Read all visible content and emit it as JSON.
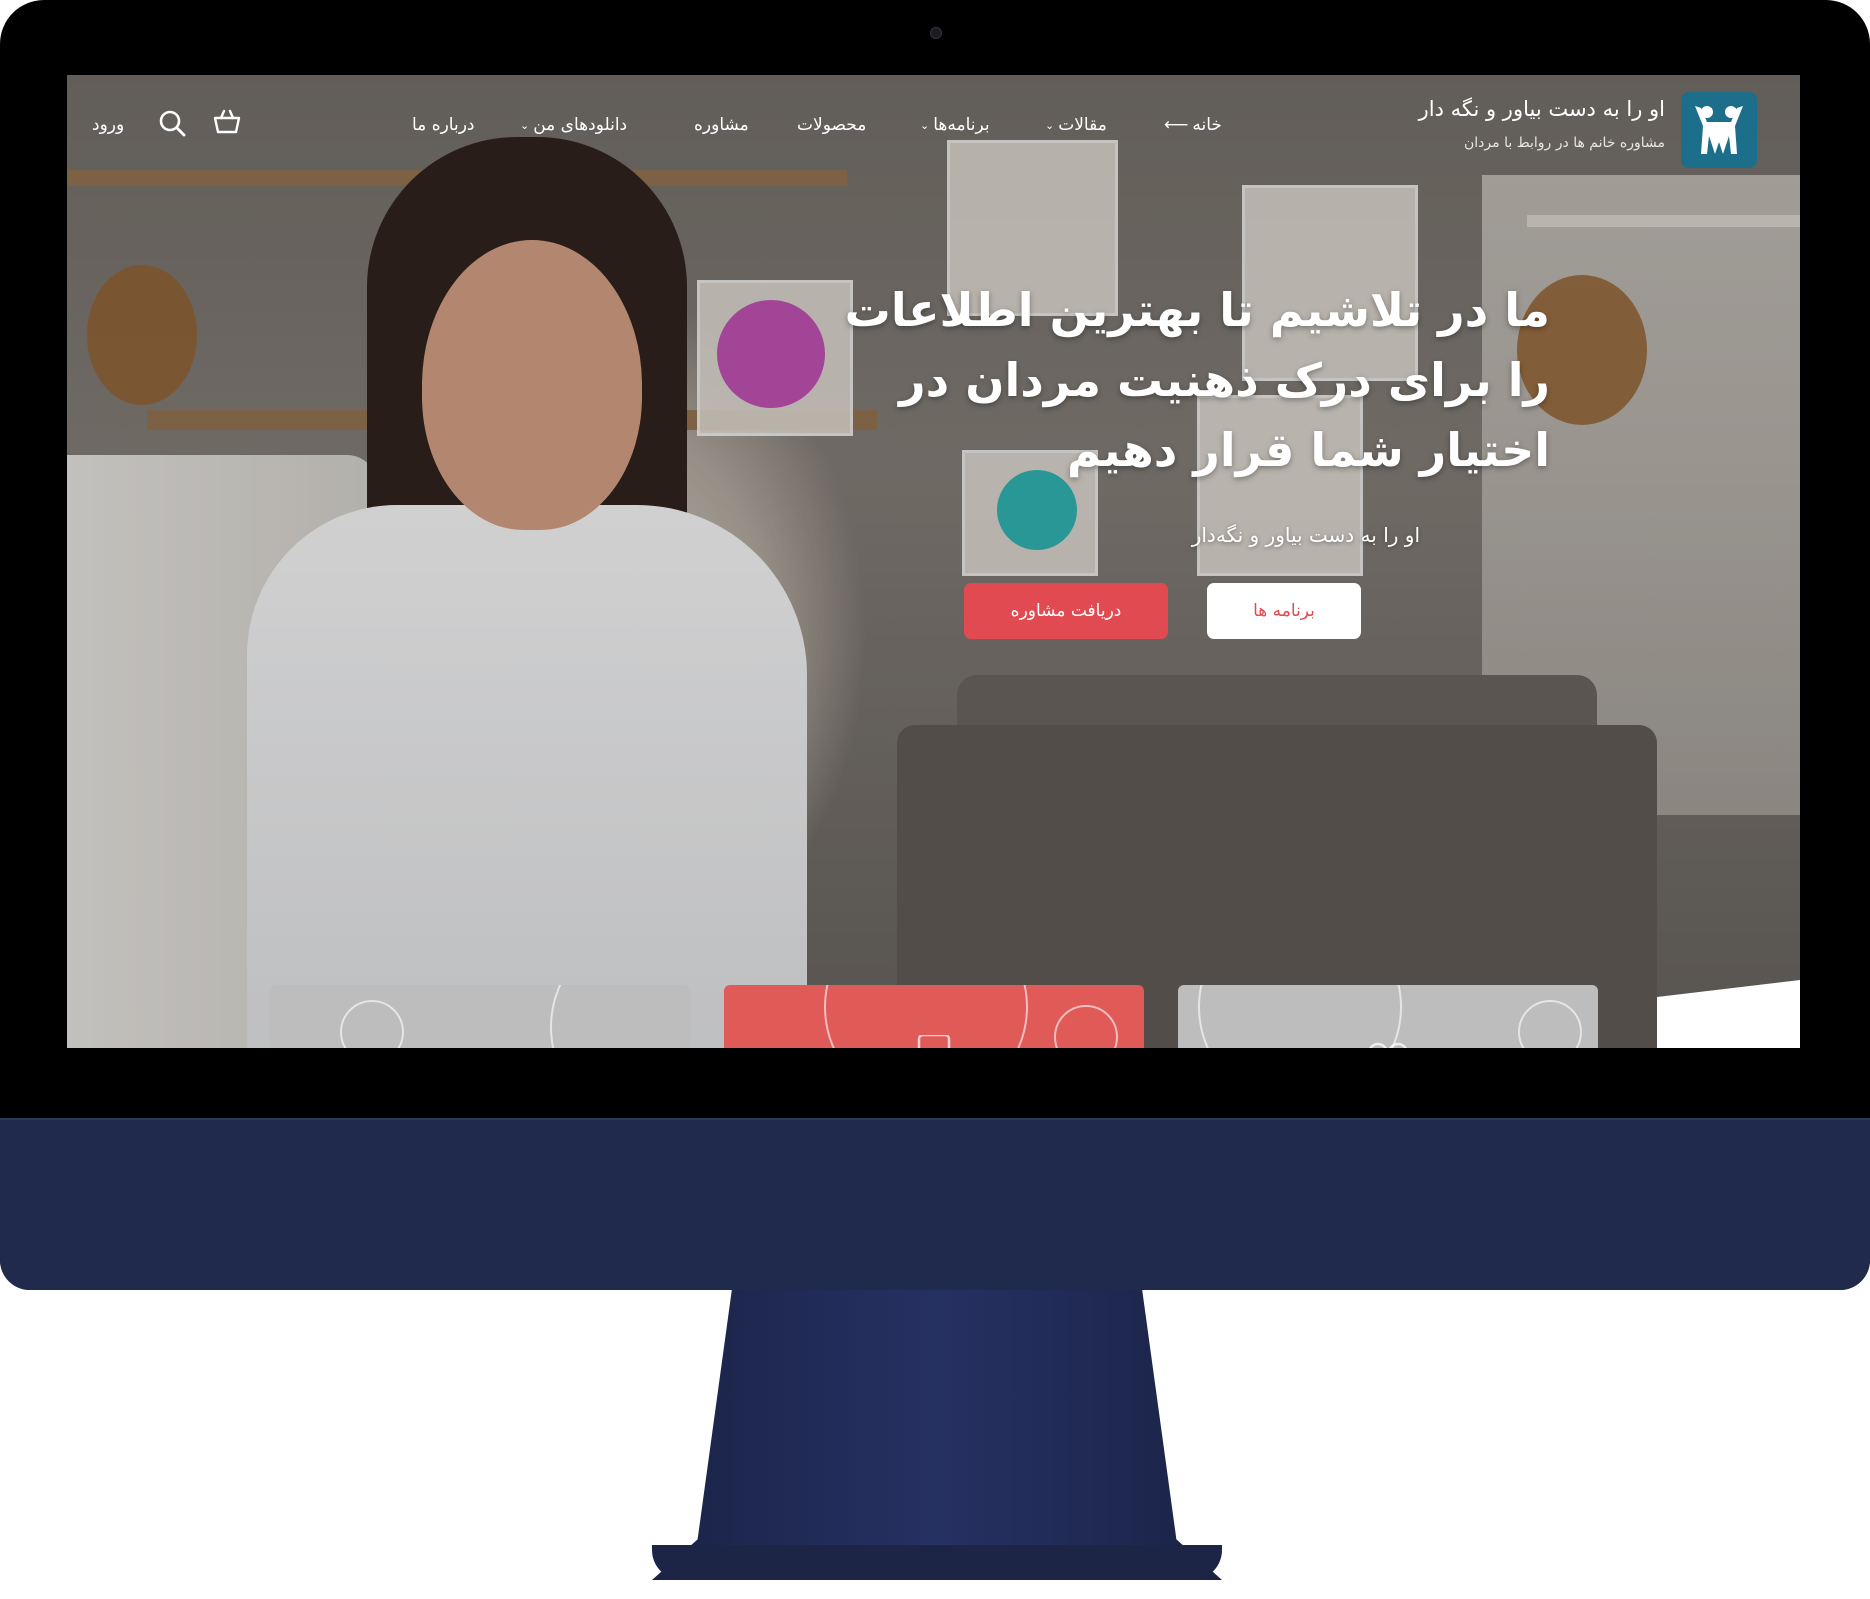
{
  "brand": {
    "title": "او را به دست بیاور و نگه دار",
    "subtitle": "مشاوره خانم ها در روابط با مردان",
    "logo_color": "#1d6e8a"
  },
  "nav": {
    "items": [
      {
        "label": "خانه",
        "icon": "arrow-left-icon"
      },
      {
        "label": "مقالات",
        "has_dropdown": true
      },
      {
        "label": "برنامه‌ها",
        "has_dropdown": true
      },
      {
        "label": "محصولات"
      },
      {
        "label": "مشاوره"
      },
      {
        "label": "دانلودهای من",
        "has_dropdown": true
      },
      {
        "label": "درباره ما"
      }
    ],
    "login_label": "ورود",
    "search_icon": "search-icon",
    "cart_icon": "basket-icon"
  },
  "hero": {
    "title": "ما در تلاشیم تا بهترین اطلاعات را برای درک ذهنیت مردان در اختیار شما قرار دهیم",
    "subtitle": "او را به دست بیاور و نگه‌دار",
    "primary_button": "دریافت مشاوره",
    "secondary_button": "برنامه ها"
  },
  "colors": {
    "accent": "#e14a50",
    "monitor_chin": "#1f2a4d",
    "card_red": "#e05a57",
    "card_gray": "#bdbdbd"
  }
}
